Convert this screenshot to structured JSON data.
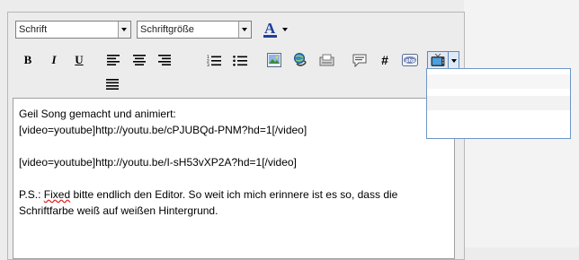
{
  "toolbar": {
    "font_select": {
      "value": "Schrift"
    },
    "size_select": {
      "value": "Schriftgröße"
    },
    "font_color_letter": "A",
    "bold_label": "B",
    "italic_label": "I",
    "underline_label": "U",
    "code_label": "#"
  },
  "editor": {
    "lines": [
      "Geil Song gemacht und animiert:",
      "[video=youtube]http://youtu.be/cPJUBQd-PNM?hd=1[/video]",
      "",
      "[video=youtube]http://youtu.be/I-sH53vXP2A?hd=1[/video]",
      "",
      "P.S.: ",
      "Fixed",
      " bitte endlich den Editor. So weit ich mich erinnere ist es so, dass die",
      "Schriftfarbe weiß auf weißen Hintergrund."
    ]
  },
  "colors": {
    "accent": "#5d88c1",
    "font_color_underline": "#1f3f9e",
    "spellcheck": "#e02020"
  }
}
